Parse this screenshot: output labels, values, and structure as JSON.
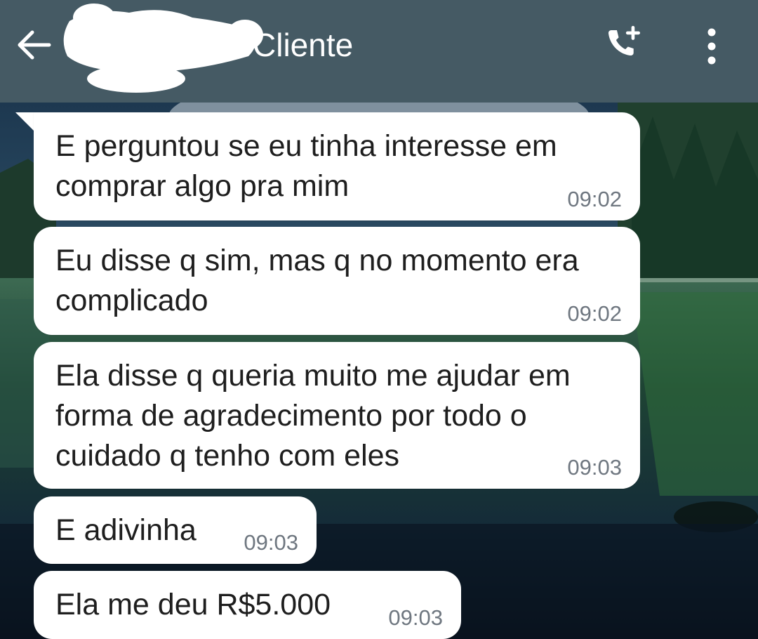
{
  "header": {
    "title": "Cliente",
    "background": "#455a64",
    "icons": [
      "arrow-left-icon",
      "add-call-icon",
      "more-vert-icon"
    ]
  },
  "messages": [
    {
      "text": "E perguntou se eu tinha interesse em comprar algo pra mim",
      "time": "09:02"
    },
    {
      "text": "Eu disse q sim, mas q no momento era complicado",
      "time": "09:02"
    },
    {
      "text": "Ela disse q queria muito me ajudar em forma de agradecimento por todo o cuidado q tenho com eles",
      "time": "09:03"
    },
    {
      "text": "E adivinha",
      "time": "09:03"
    },
    {
      "text": "Ela me deu R$5.000",
      "time": "09:03"
    }
  ],
  "colors": {
    "bubble": "#ffffff",
    "text": "#1e1e1e",
    "timestamp": "#6f7780"
  }
}
